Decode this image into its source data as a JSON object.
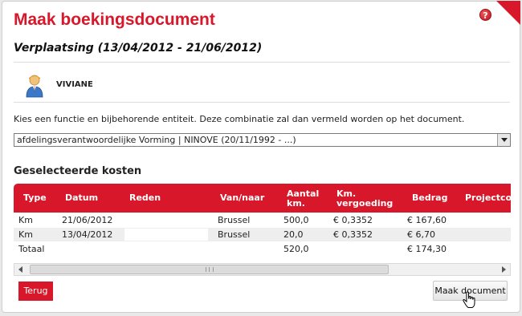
{
  "dialog": {
    "title": "Maak boekingsdocument",
    "subtitle": "Verplaatsing (13/04/2012 - 21/06/2012)",
    "help_icon": "question-mark-icon"
  },
  "person": {
    "name": "VIVIANE",
    "icon": "user-avatar-icon"
  },
  "instruction": "Kies een functie en bijbehorende entiteit. Deze combinatie zal dan vermeld worden op het document.",
  "function_select": {
    "selected": "afdelingsverantwoordelijke Vorming | NINOVE (20/11/1992 - ...)"
  },
  "costs": {
    "title": "Geselecteerde kosten",
    "columns": {
      "type": "Type",
      "datum": "Datum",
      "reden": "Reden",
      "vannaar": "Van/naar",
      "aantal_l1": "Aantal",
      "aantal_l2": "km.",
      "verg_l1": "Km.",
      "verg_l2": "vergoeding",
      "bedrag": "Bedrag",
      "project": "Projectco"
    },
    "rows": [
      {
        "type": "Km",
        "datum": "21/06/2012",
        "reden": "",
        "vannaar": "Brussel",
        "aantal": "500,0",
        "vergoeding": "€ 0,3352",
        "bedrag": "€ 167,60"
      },
      {
        "type": "Km",
        "datum": "13/04/2012",
        "reden": "",
        "vannaar": "Brussel",
        "aantal": "20,0",
        "vergoeding": "€ 0,3352",
        "bedrag": "€ 6,70"
      }
    ],
    "total": {
      "label": "Totaal",
      "aantal": "520,0",
      "bedrag": "€ 174,30"
    }
  },
  "buttons": {
    "back": "Terug",
    "make_document": "Maak document"
  },
  "colors": {
    "accent": "#d8182a"
  }
}
